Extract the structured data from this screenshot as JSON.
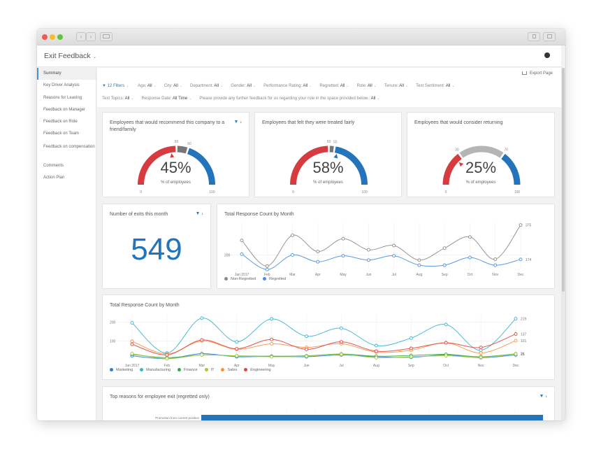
{
  "window": {
    "nav_back": "‹",
    "nav_forward": "›"
  },
  "header": {
    "title": "Exit Feedback",
    "title_chevron": "⌄",
    "user_icon": "user-icon"
  },
  "sidebar": {
    "items": [
      {
        "label": "Summary",
        "active": true
      },
      {
        "label": "Key Driver Analysis"
      },
      {
        "label": "Reasons for Leaving"
      },
      {
        "label": "Feedback on Manager"
      },
      {
        "label": "Feedback on Role"
      },
      {
        "label": "Feedback on Team"
      },
      {
        "label": "Feedback on compensation"
      },
      {
        "label": "Comments"
      },
      {
        "label": "Action Plan"
      }
    ]
  },
  "toolbar": {
    "export_label": "Export Page"
  },
  "filters": {
    "summary_label": "12 Filters",
    "row1": [
      {
        "name": "Age",
        "value": "All"
      },
      {
        "name": "City",
        "value": "All"
      },
      {
        "name": "Department",
        "value": "All"
      },
      {
        "name": "Gender",
        "value": "All"
      },
      {
        "name": "Performance Rating",
        "value": "All"
      },
      {
        "name": "Regretted",
        "value": "All"
      },
      {
        "name": "Role",
        "value": "All"
      },
      {
        "name": "Tenure",
        "value": "All"
      },
      {
        "name": "Text Sentiment",
        "value": "All"
      }
    ],
    "row2": [
      {
        "name": "Text Topics",
        "value": "All"
      },
      {
        "name": "Response Date",
        "value": "All Time"
      },
      {
        "name": "Please provide any further feedback for us regarding your role in the space provided below.",
        "value": "All"
      }
    ]
  },
  "gauges": [
    {
      "title": "Employees that would recommend this company to a friend/family",
      "value_label": "45%",
      "value": 45,
      "subtitle": "% of employees",
      "min_label": "0",
      "max_label": "100",
      "threshold_low": 50,
      "threshold_high": 60,
      "threshold_low_label": "50",
      "threshold_high_label": "60",
      "filter_count": "1",
      "has_filter": true
    },
    {
      "title": "Employees that felt they were treated fairly",
      "value_label": "58%",
      "value": 58,
      "subtitle": "% of employees",
      "min_label": "0",
      "max_label": "100",
      "threshold_low": 50,
      "threshold_high": 55,
      "threshold_low_label": "50",
      "threshold_high_label": "55",
      "has_filter": false
    },
    {
      "title": "Employees that would consider returning",
      "value_label": "25%",
      "value": 25,
      "subtitle": "% of employees",
      "min_label": "0",
      "max_label": "100",
      "threshold_low": 30,
      "threshold_high": 70,
      "threshold_low_label": "30",
      "threshold_high_label": "70",
      "has_filter": false
    }
  ],
  "colors": {
    "red": "#d63b3f",
    "gray": "#777777",
    "light_gray": "#b5b5b5",
    "blue": "#2374bb"
  },
  "exits_card": {
    "title": "Number of exits this month",
    "value": "549",
    "filter_count": "1"
  },
  "top_reasons": {
    "title": "Top reasons for employee exit (regretted only)",
    "filter_count": "1",
    "bars": [
      {
        "label": "Promotion from current position",
        "value": 1.0
      }
    ]
  },
  "chart_data": [
    {
      "type": "line",
      "title": "Total Response Count by Month",
      "categories": [
        "Jan 2017",
        "Feb",
        "Mar",
        "Apr",
        "May",
        "Jun",
        "Jul",
        "Aug",
        "Sep",
        "Oct",
        "Nov",
        "Dec"
      ],
      "ylim": [
        120,
        390
      ],
      "yticks": [
        200
      ],
      "end_labels": [
        "375",
        "174"
      ],
      "series": [
        {
          "name": "Non-Regretted",
          "color": "#8a8a8a",
          "values": [
            285,
            135,
            315,
            220,
            295,
            230,
            255,
            170,
            240,
            305,
            175,
            375
          ]
        },
        {
          "name": "Regretted",
          "color": "#4a90d9",
          "values": [
            205,
            115,
            200,
            160,
            195,
            170,
            195,
            140,
            140,
            185,
            140,
            174
          ]
        }
      ],
      "legend": "bottom-left",
      "grid": true
    },
    {
      "type": "line",
      "title": "Total Response Count by Month",
      "categories": [
        "Jan 2017",
        "Feb",
        "Mar",
        "Apr",
        "May",
        "Jun",
        "Jul",
        "Aug",
        "Sep",
        "Oct",
        "Nov",
        "Dec"
      ],
      "ylim": [
        0,
        240
      ],
      "yticks": [
        100,
        200
      ],
      "end_labels": [
        "219",
        "137",
        "101",
        "31",
        "25"
      ],
      "series": [
        {
          "name": "Marketing",
          "color": "#2a7de1",
          "values": [
            20,
            5,
            32,
            15,
            18,
            15,
            25,
            15,
            12,
            25,
            10,
            25
          ]
        },
        {
          "name": "Manufacturing",
          "color": "#3ab4d0",
          "values": [
            197,
            35,
            222,
            95,
            218,
            125,
            168,
            75,
            115,
            188,
            50,
            219
          ]
        },
        {
          "name": "Finance",
          "color": "#3aa845",
          "values": [
            28,
            10,
            25,
            20,
            18,
            20,
            30,
            18,
            22,
            28,
            15,
            31
          ]
        },
        {
          "name": "IT",
          "color": "#a6c93a",
          "values": [
            32,
            5,
            25,
            20,
            15,
            18,
            28,
            10,
            15,
            20,
            12,
            30
          ]
        },
        {
          "name": "Sales",
          "color": "#f5923e",
          "values": [
            98,
            30,
            100,
            55,
            85,
            65,
            85,
            40,
            50,
            90,
            35,
            101
          ]
        },
        {
          "name": "Engineering",
          "color": "#e04343",
          "values": [
            82,
            25,
            105,
            58,
            108,
            55,
            95,
            45,
            60,
            90,
            65,
            137
          ]
        }
      ],
      "legend": "bottom-left",
      "grid": true
    }
  ]
}
